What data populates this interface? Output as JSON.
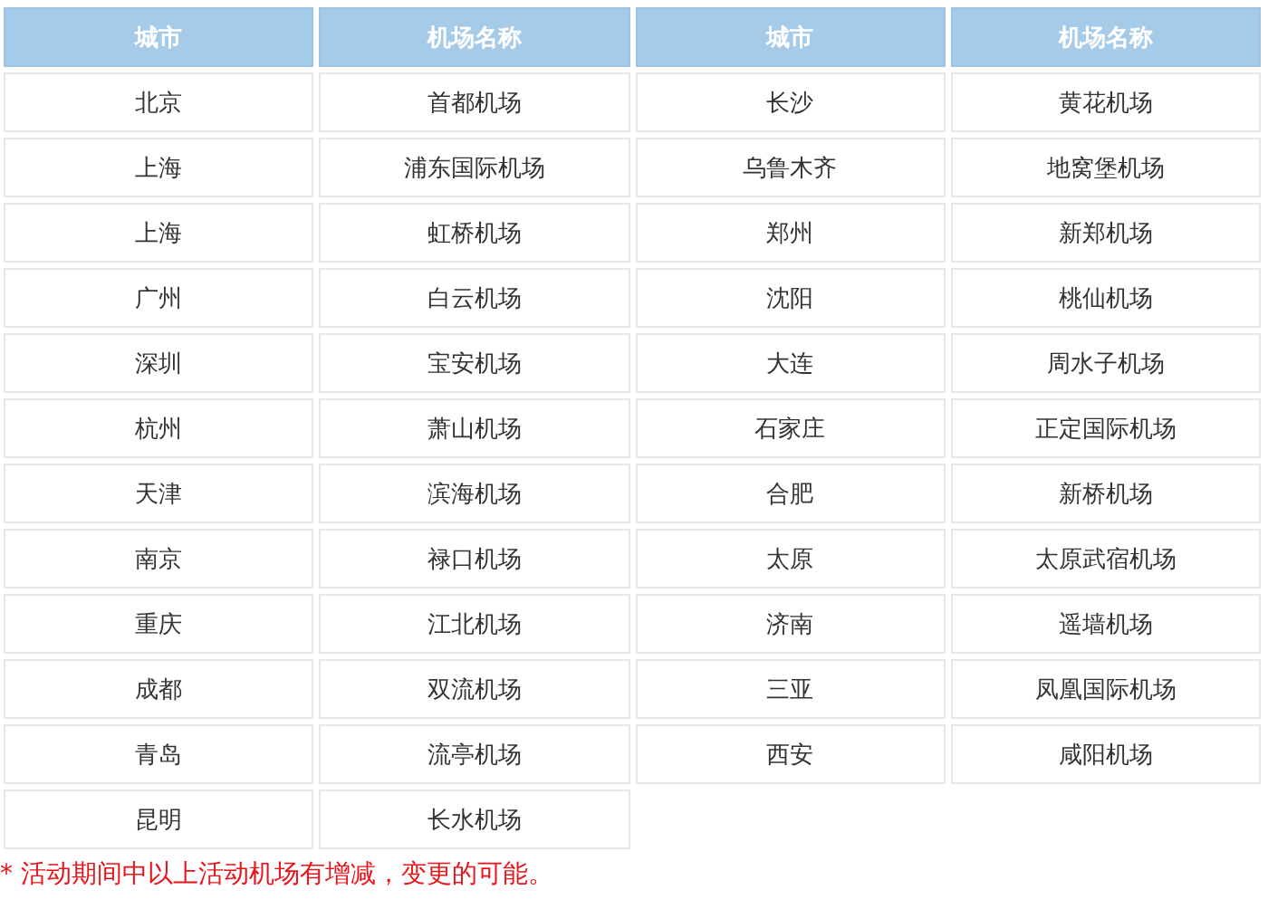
{
  "table": {
    "columns": [
      "城市",
      "机场名称",
      "城市",
      "机场名称"
    ],
    "rows": [
      [
        "北京",
        "首都机场",
        "长沙",
        "黄花机场"
      ],
      [
        "上海",
        "浦东国际机场",
        "乌鲁木齐",
        "地窝堡机场"
      ],
      [
        "上海",
        "虹桥机场",
        "郑州",
        "新郑机场"
      ],
      [
        "广州",
        "白云机场",
        "沈阳",
        "桃仙机场"
      ],
      [
        "深圳",
        "宝安机场",
        "大连",
        "周水子机场"
      ],
      [
        "杭州",
        "萧山机场",
        "石家庄",
        "正定国际机场"
      ],
      [
        "天津",
        "滨海机场",
        "合肥",
        "新桥机场"
      ],
      [
        "南京",
        "禄口机场",
        "太原",
        "太原武宿机场"
      ],
      [
        "重庆",
        "江北机场",
        "济南",
        "遥墙机场"
      ],
      [
        "成都",
        "双流机场",
        "三亚",
        "凤凰国际机场"
      ],
      [
        "青岛",
        "流亭机场",
        "西安",
        "咸阳机场"
      ],
      [
        "昆明",
        "长水机场"
      ]
    ]
  },
  "note": "* 活动期间中以上活动机场有增减，变更的可能。"
}
